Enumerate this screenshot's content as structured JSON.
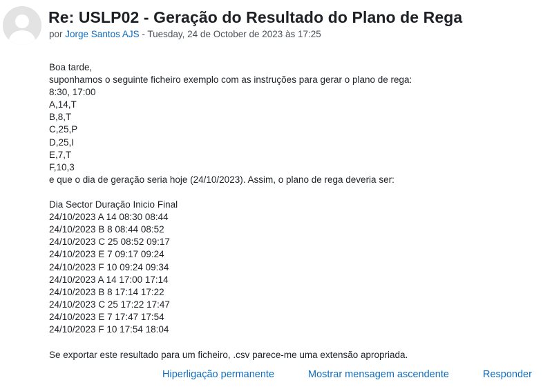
{
  "post": {
    "subject": "Re: USLP02 - Geração do Resultado do Plano de Rega",
    "byline_prefix": "por",
    "author": "Jorge Santos AJS",
    "byline_separator": "-",
    "date": "Tuesday, 24 de October de 2023 às 17:25",
    "avatar_icon": "user-avatar-icon"
  },
  "body": {
    "intro_lines": [
      "Boa tarde,",
      "suponhamos o seguinte ficheiro exemplo com as instruções para gerar o plano de rega:",
      "8:30, 17:00",
      "A,14,T",
      "B,8,T",
      "C,25,P",
      "D,25,I",
      "E,7,T",
      "F,10,3",
      "e que o dia de geração seria hoje (24/10/2023). Assim, o plano de rega deveria ser:"
    ],
    "table_header": "Dia Sector Duração Inicio Final",
    "table_rows": [
      "24/10/2023 A 14 08:30 08:44",
      "24/10/2023 B 8 08:44 08:52",
      "24/10/2023 C 25 08:52 09:17",
      "24/10/2023 E 7 09:17 09:24",
      "24/10/2023 F 10 09:24 09:34",
      "24/10/2023 A 14 17:00 17:14",
      "24/10/2023 B 8 17:14 17:22",
      "24/10/2023 C 25 17:22 17:47",
      "24/10/2023 E 7 17:47 17:54",
      "24/10/2023 F 10 17:54 18:04"
    ],
    "closing": "Se exportar este resultado para um ficheiro, .csv parece-me uma extensão apropriada."
  },
  "commands": {
    "permalink": "Hiperligação permanente",
    "show_parent": "Mostrar mensagem ascendente",
    "reply": "Responder"
  },
  "colors": {
    "link": "#0f6cbf",
    "text": "#1d2125",
    "muted": "#495057",
    "avatar_bg": "#e3e3e3"
  }
}
